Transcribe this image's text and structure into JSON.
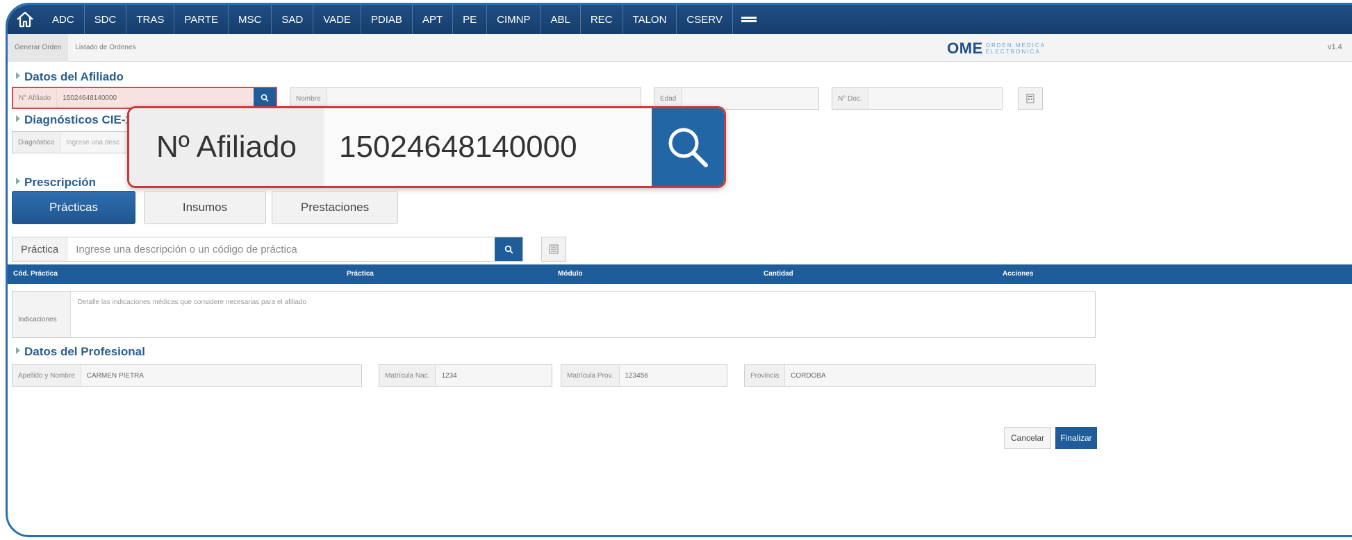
{
  "nav": {
    "items": [
      "ADC",
      "SDC",
      "TRAS",
      "PARTE",
      "MSC",
      "SAD",
      "VADE",
      "PDIAB",
      "APT",
      "PE",
      "CIMNP",
      "ABL",
      "REC",
      "TALON",
      "CSERV"
    ]
  },
  "subnav": {
    "tabs": [
      "Generar Orden",
      "Listado de Ordenes"
    ],
    "brand_main": "OME",
    "brand_sub_line1": "ORDEN MEDICA",
    "brand_sub_line2": "ELECTRONICA",
    "version": "v1.4"
  },
  "afiliado": {
    "section_title": "Datos del Afiliado",
    "numero_label": "N° Afiliado",
    "numero_value": "15024648140000",
    "nombre_label": "Nombre",
    "edad_label": "Edad",
    "doc_label": "N° Doc."
  },
  "diagnosticos": {
    "section_title": "Diagnósticos CIE-10",
    "label": "Diagnóstico",
    "placeholder": "Ingrese una desc"
  },
  "callout": {
    "label": "Nº Afiliado",
    "value": "15024648140000"
  },
  "prescripcion": {
    "section_title": "Prescripción",
    "tabs": [
      "Prácticas",
      "Insumos",
      "Prestaciones"
    ],
    "practica_label": "Práctica",
    "practica_placeholder": "Ingrese una descripción o un código de práctica",
    "table_headers": [
      "Cód. Práctica",
      "Práctica",
      "Módulo",
      "Cantidad",
      "Acciones"
    ],
    "indicaciones_label": "Indicaciones",
    "indicaciones_placeholder": "Detalle las indicaciones médicas que considere necesarias para el afiliado"
  },
  "profesional": {
    "section_title": "Datos del Profesional",
    "nombre_label": "Apellido y Nombre",
    "nombre_value": "CARMEN PIETRA",
    "mat_nac_label": "Matrícula Nac.",
    "mat_nac_value": "1234",
    "mat_prov_label": "Matrícula Prov.",
    "mat_prov_value": "123456",
    "provincia_label": "Provincia",
    "provincia_value": "CORDOBA"
  },
  "actions": {
    "cancel": "Cancelar",
    "finish": "Finalizar"
  },
  "colors": {
    "primary": "#1f5d9a",
    "nav": "#1f4f86",
    "highlight": "#c93a3a"
  }
}
